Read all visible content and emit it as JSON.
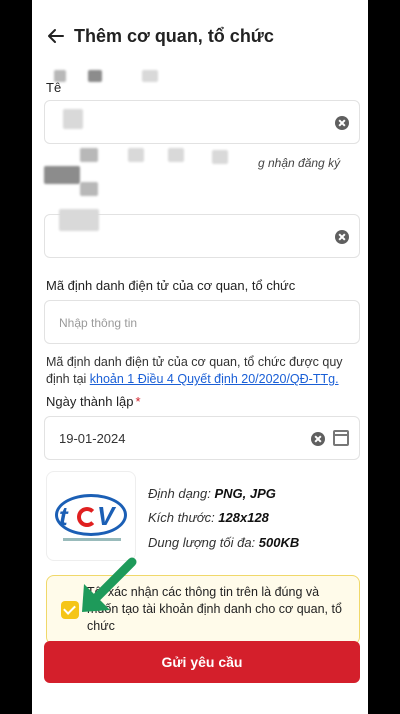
{
  "header": {
    "title": "Thêm cơ quan, tổ chức"
  },
  "form": {
    "name_label_partial": "Tê",
    "cert_hint_partial": "g nhận đăng ký",
    "eid_label": "Mã định danh điện tử của cơ quan, tổ chức",
    "eid_placeholder": "Nhập thông tin",
    "eid_note": "Mã định danh điện tử của cơ quan, tổ chức được quy định tại ",
    "eid_note_link": "khoản 1 Điều 4 Quyết định 20/2020/QĐ-TTg.",
    "founded_label": "Ngày thành lập",
    "founded_required": "*",
    "founded_value": "19-01-2024"
  },
  "logo": {
    "format_label": "Định dạng: ",
    "format_value": "PNG, JPG",
    "size_label": "Kích thước: ",
    "size_value": "128x128",
    "max_label": "Dung lượng tối đa: ",
    "max_value": "500KB"
  },
  "confirm": {
    "text": "Tôi xác nhận các thông tin trên là đúng và muốn tạo tài khoản định danh cho cơ quan, tổ chức",
    "checked": true
  },
  "submit_label": "Gửi yêu cầu",
  "colors": {
    "accent": "#d41f2b",
    "link": "#1a5fd6",
    "checkbox": "#f5c518",
    "arrow": "#1e9a5a"
  },
  "icons": [
    "back-arrow-icon",
    "clear-icon",
    "calendar-icon",
    "check-icon",
    "pointer-arrow-icon"
  ]
}
